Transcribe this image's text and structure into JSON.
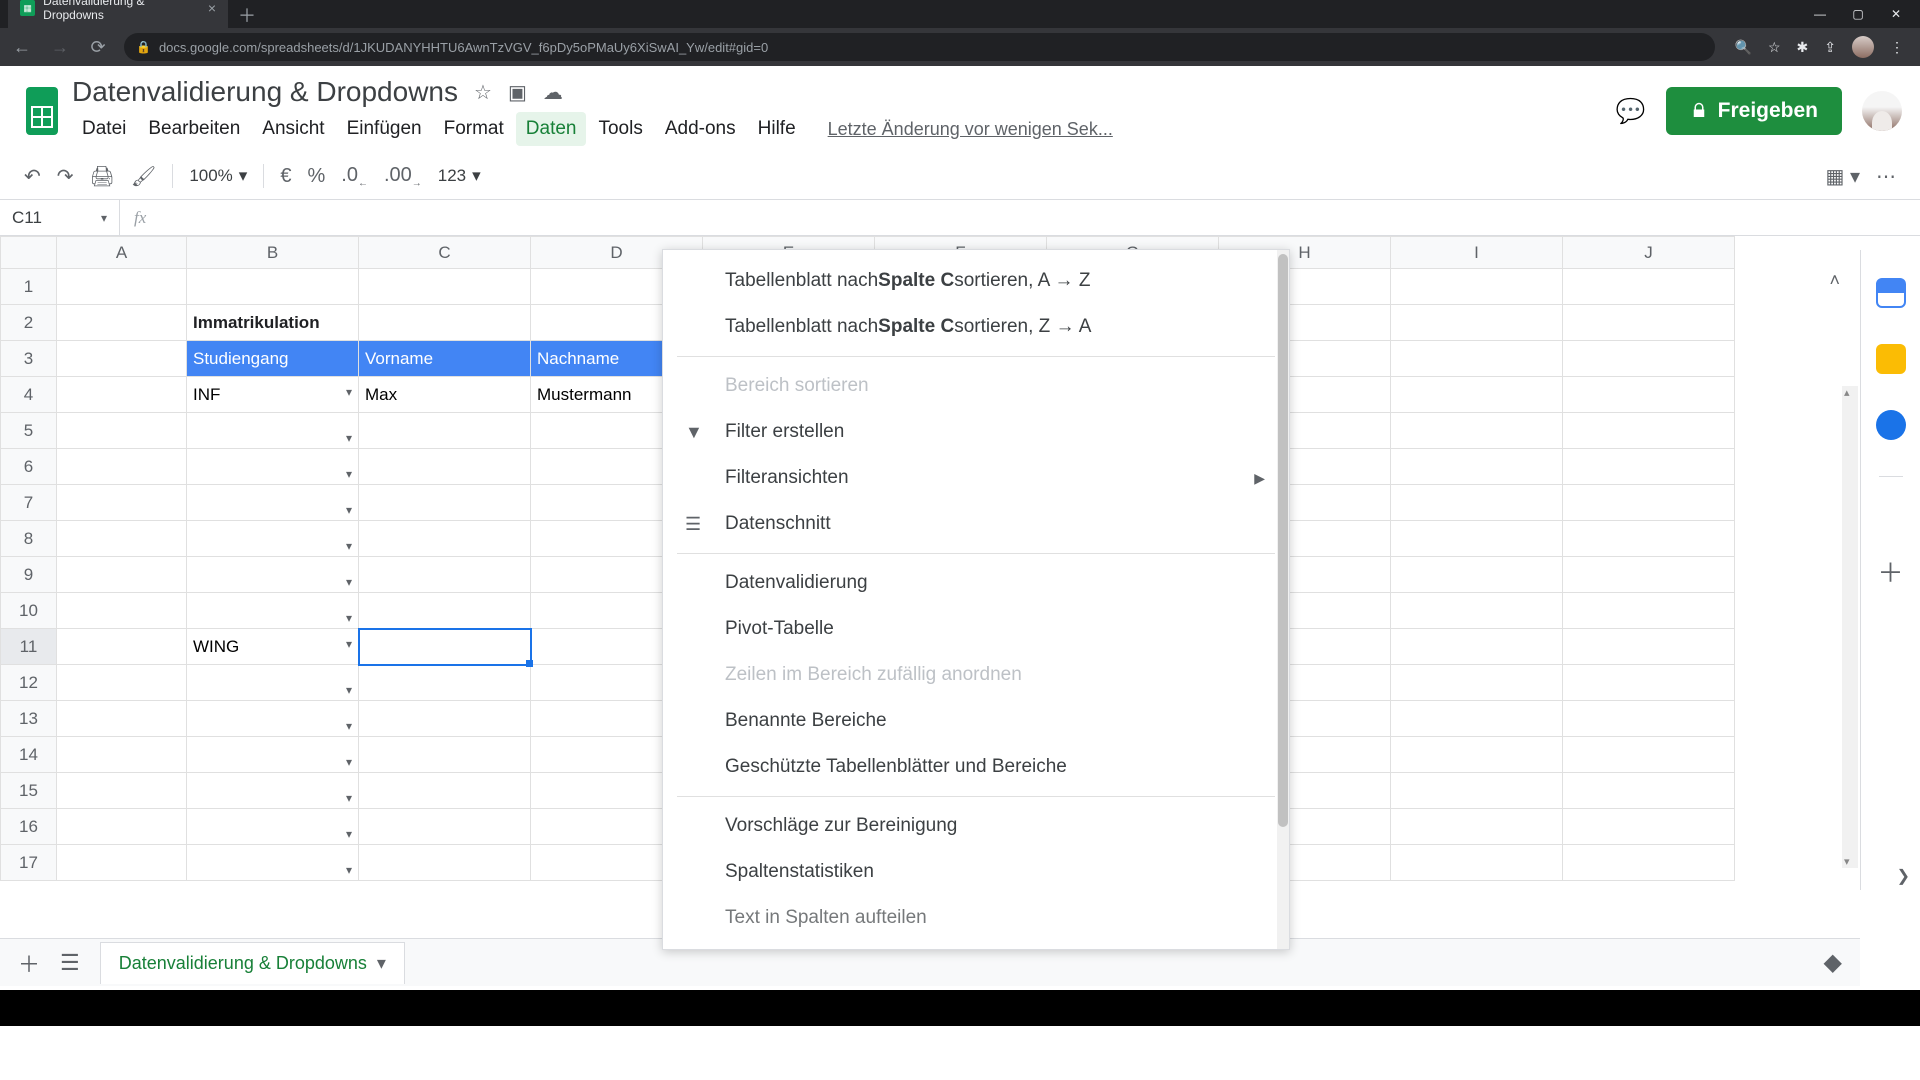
{
  "browser": {
    "tab_title": "Datenvalidierung & Dropdowns",
    "url": "docs.google.com/spreadsheets/d/1JKUDANYHHTU6AwnTzVGV_f6pDy5oPMaUy6XiSwAI_Yw/edit#gid=0"
  },
  "doc": {
    "title": "Datenvalidierung & Dropdowns",
    "last_edit": "Letzte Änderung vor wenigen Sek...",
    "share_label": "Freigeben"
  },
  "menus": {
    "file": "Datei",
    "edit": "Bearbeiten",
    "view": "Ansicht",
    "insert": "Einfügen",
    "format": "Format",
    "data": "Daten",
    "tools": "Tools",
    "addons": "Add-ons",
    "help": "Hilfe"
  },
  "toolbar": {
    "zoom": "100%",
    "currency": "€",
    "percent": "%",
    "dec_dec": ".0",
    "inc_dec": ".00",
    "numfmt": "123"
  },
  "formula": {
    "cell": "C11",
    "fx": "fx"
  },
  "cols": [
    "A",
    "B",
    "C",
    "D",
    "E",
    "F",
    "G",
    "H",
    "I",
    "J"
  ],
  "rows": [
    "1",
    "2",
    "3",
    "4",
    "5",
    "6",
    "7",
    "8",
    "9",
    "10",
    "11",
    "12",
    "13",
    "14",
    "15",
    "16",
    "17"
  ],
  "table": {
    "title": "Immatrikulation",
    "headers": {
      "b": "Studiengang",
      "c": "Vorname",
      "d": "Nachname"
    },
    "r4": {
      "b": "INF",
      "c": "Max",
      "d": "Mustermann"
    },
    "r11b": "WING"
  },
  "data_menu": {
    "sort_az_pre": "Tabellenblatt nach ",
    "sort_col": "Spalte C",
    "sort_az_post": " sortieren, A → Z",
    "sort_za_post": " sortieren, Z → A",
    "sort_range": "Bereich sortieren",
    "create_filter": "Filter erstellen",
    "filter_views": "Filteransichten",
    "slicer": "Datenschnitt",
    "validation": "Datenvalidierung",
    "pivot": "Pivot-Tabelle",
    "randomize": "Zeilen im Bereich zufällig anordnen",
    "named_ranges": "Benannte Bereiche",
    "protected": "Geschützte Tabellenblätter und Bereiche",
    "cleanup": "Vorschläge zur Bereinigung",
    "col_stats": "Spaltenstatistiken",
    "split_text": "Text in Spalten aufteilen"
  },
  "sheet_tab": "Datenvalidierung & Dropdowns"
}
